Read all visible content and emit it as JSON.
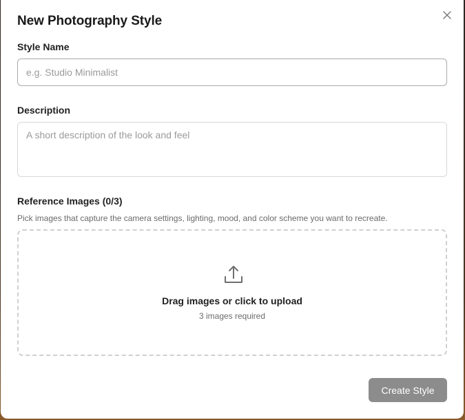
{
  "modal": {
    "title": "New Photography Style",
    "close_icon": "close-icon"
  },
  "style_name": {
    "label": "Style Name",
    "value": "",
    "placeholder": "e.g. Studio Minimalist"
  },
  "description": {
    "label": "Description",
    "value": "",
    "placeholder": "A short description of the look and feel"
  },
  "reference_images": {
    "label": "Reference Images (0/3)",
    "helper": "Pick images that capture the camera settings, lighting, mood, and color scheme you want to recreate.",
    "dropzone": {
      "icon": "upload-icon",
      "main_text": "Drag images or click to upload",
      "sub_text": "3 images required"
    }
  },
  "actions": {
    "create_label": "Create Style",
    "create_color": "#8c8c8c"
  }
}
